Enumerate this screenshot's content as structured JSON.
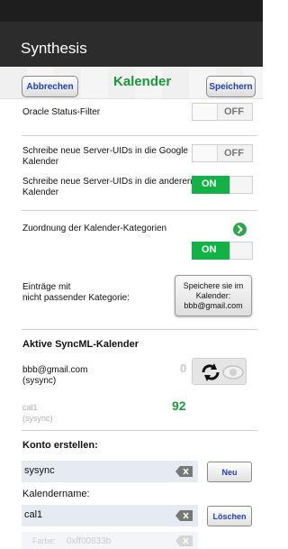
{
  "app": {
    "title": "Synthesis"
  },
  "toolbar": {
    "cancel_label": "Abbrechen",
    "title": "Kalender",
    "save_label": "Speichern"
  },
  "settings": {
    "oracle_filter": {
      "label": "Oracle Status-Filter",
      "state": "OFF"
    },
    "uids_google": {
      "label_line1": "Schreibe neue Server-UIDs in die Google",
      "label_line2": "Kalender",
      "state": "OFF"
    },
    "uids_other": {
      "label_line1": "Schreibe neue Server-UIDs in die anderen",
      "label_line2": "Kalender",
      "state": "ON"
    },
    "category_mapping": {
      "label": "Zuordnung der Kalender-Kategorien",
      "state": "ON"
    },
    "unmatched": {
      "label_line1": "Einträge mit",
      "label_line2": "nicht passender Kategorie:",
      "button_line1": "Speichere sie im",
      "button_line2": "Kalender:",
      "button_line3": "bbb@gmail.com"
    }
  },
  "sync_calendars": {
    "title": "Aktive SyncML-Kalender",
    "items": [
      {
        "name": "bbb@gmail.com",
        "sub": "(sysync)",
        "count": "0"
      },
      {
        "name": "cal1",
        "sub": "(sysync)",
        "count": "92"
      }
    ]
  },
  "create_account": {
    "title": "Konto erstellen:",
    "account_value": "sysync",
    "new_label": "Neu",
    "calendar_name_label": "Kalendername:",
    "calendar_value": "cal1",
    "delete_label": "Löschen",
    "color_label": "Farbe:",
    "color_value": "0xff00833b"
  },
  "colors": {
    "accent_green": "#12b247",
    "title_green": "#1a9a3a",
    "button_blue": "#1e3fb8"
  }
}
